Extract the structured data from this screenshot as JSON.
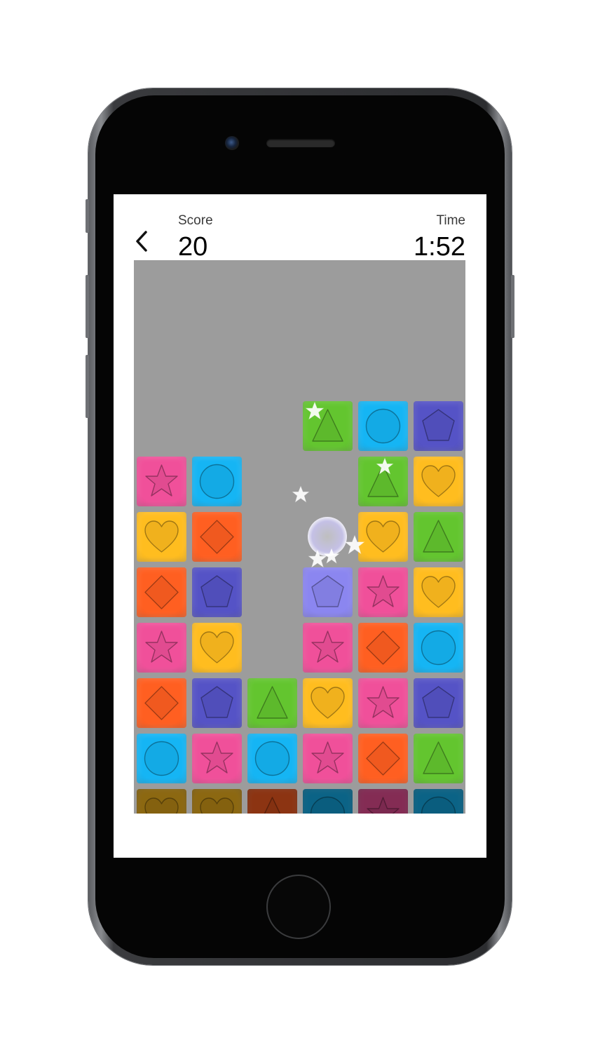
{
  "hud": {
    "score_label": "Score",
    "score_value": "20",
    "time_label": "Time",
    "time_value": "1:52"
  },
  "icons": {
    "back": "chevron-left-icon",
    "sparkle": "star-sparkle-icon"
  },
  "colors": {
    "pink": "#f0509a",
    "cyan": "#15b5f4",
    "yellow": "#ffbd1f",
    "orange": "#ff5f21",
    "indigo": "#5553c6",
    "green": "#63c52f",
    "lavender": "#8b86f0",
    "board": "#9c9c9c"
  },
  "board": {
    "columns": 6,
    "tiles": [
      {
        "col": 3,
        "row": 0,
        "shape": "triangle",
        "color": "green"
      },
      {
        "col": 4,
        "row": 0,
        "shape": "circle",
        "color": "cyan"
      },
      {
        "col": 5,
        "row": 0,
        "shape": "pentagon",
        "color": "indigo"
      },
      {
        "col": 0,
        "row": 1,
        "shape": "star",
        "color": "pink"
      },
      {
        "col": 1,
        "row": 1,
        "shape": "circle",
        "color": "cyan"
      },
      {
        "col": 4,
        "row": 1,
        "shape": "triangle",
        "color": "green"
      },
      {
        "col": 5,
        "row": 1,
        "shape": "heart",
        "color": "yellow"
      },
      {
        "col": 0,
        "row": 2,
        "shape": "heart",
        "color": "yellow"
      },
      {
        "col": 1,
        "row": 2,
        "shape": "diamond",
        "color": "orange"
      },
      {
        "col": 4,
        "row": 2,
        "shape": "heart",
        "color": "yellow"
      },
      {
        "col": 5,
        "row": 2,
        "shape": "triangle",
        "color": "green"
      },
      {
        "col": 0,
        "row": 3,
        "shape": "diamond",
        "color": "orange"
      },
      {
        "col": 1,
        "row": 3,
        "shape": "pentagon",
        "color": "indigo"
      },
      {
        "col": 3,
        "row": 3,
        "shape": "pentagon",
        "color": "lavender"
      },
      {
        "col": 4,
        "row": 3,
        "shape": "star",
        "color": "pink"
      },
      {
        "col": 5,
        "row": 3,
        "shape": "heart",
        "color": "yellow"
      },
      {
        "col": 0,
        "row": 4,
        "shape": "star",
        "color": "pink"
      },
      {
        "col": 1,
        "row": 4,
        "shape": "heart",
        "color": "yellow"
      },
      {
        "col": 3,
        "row": 4,
        "shape": "star",
        "color": "pink"
      },
      {
        "col": 4,
        "row": 4,
        "shape": "diamond",
        "color": "orange"
      },
      {
        "col": 5,
        "row": 4,
        "shape": "circle",
        "color": "cyan"
      },
      {
        "col": 0,
        "row": 5,
        "shape": "diamond",
        "color": "orange"
      },
      {
        "col": 1,
        "row": 5,
        "shape": "pentagon",
        "color": "indigo"
      },
      {
        "col": 2,
        "row": 5,
        "shape": "triangle",
        "color": "green"
      },
      {
        "col": 3,
        "row": 5,
        "shape": "heart",
        "color": "yellow"
      },
      {
        "col": 4,
        "row": 5,
        "shape": "star",
        "color": "pink"
      },
      {
        "col": 5,
        "row": 5,
        "shape": "pentagon",
        "color": "indigo"
      },
      {
        "col": 0,
        "row": 6,
        "shape": "circle",
        "color": "cyan"
      },
      {
        "col": 1,
        "row": 6,
        "shape": "star",
        "color": "pink"
      },
      {
        "col": 2,
        "row": 6,
        "shape": "circle",
        "color": "cyan"
      },
      {
        "col": 3,
        "row": 6,
        "shape": "star",
        "color": "pink"
      },
      {
        "col": 4,
        "row": 6,
        "shape": "diamond",
        "color": "orange"
      },
      {
        "col": 5,
        "row": 6,
        "shape": "triangle",
        "color": "green"
      },
      {
        "col": 0,
        "row": 7,
        "shape": "heart",
        "color": "yellow",
        "dim": true
      },
      {
        "col": 1,
        "row": 7,
        "shape": "heart",
        "color": "yellow",
        "dim": true
      },
      {
        "col": 2,
        "row": 7,
        "shape": "triangle",
        "color": "orange",
        "dim": true
      },
      {
        "col": 3,
        "row": 7,
        "shape": "circle",
        "color": "cyan",
        "dim": true
      },
      {
        "col": 4,
        "row": 7,
        "shape": "star",
        "color": "pink",
        "dim": true
      },
      {
        "col": 5,
        "row": 7,
        "shape": "circle",
        "color": "cyan",
        "dim": true
      }
    ]
  }
}
